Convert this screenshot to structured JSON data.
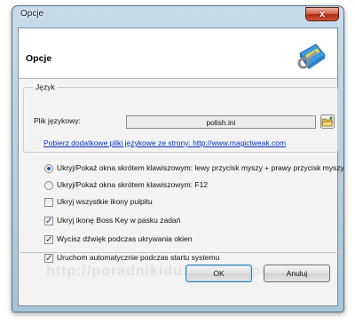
{
  "window": {
    "title": "Opcje",
    "close_label": "x"
  },
  "header": {
    "title": "Opcje",
    "icon": "settings-wrench-icon"
  },
  "language_group": {
    "label": "Język",
    "file_label": "Plik językowy:",
    "file_value": "polish.ini",
    "browse_icon": "folder-open-icon",
    "download_link": "Pobierz dodatkowe pliki językowe ze strony: http://www.magictweak.com"
  },
  "options": {
    "radio_mouse": {
      "label": "Ukryj/Pokaż okna skrótem klawiszowym: lewy przycisk myszy + prawy przycisk myszy",
      "selected": true
    },
    "radio_key": {
      "label": "Ukryj/Pokaż okna skrótem klawiszowym:  F12",
      "selected": false
    },
    "hide_desktop_icons": {
      "label": "Ukryj wszystkie ikony pulpitu",
      "checked": false
    },
    "hide_taskbar_icon": {
      "label": "Ukryj ikonę Boss Key w pasku zadań",
      "checked": true
    },
    "mute_sound": {
      "label": "Wycisz dźwięk podczas ukrywania okien",
      "checked": true
    },
    "autostart": {
      "label": "Uruchom automatycznie podczas startu systemu",
      "checked": true
    }
  },
  "buttons": {
    "ok": "OK",
    "cancel": "Anuluj"
  },
  "watermark": "http://poradnikiduzej.blogspot.com"
}
